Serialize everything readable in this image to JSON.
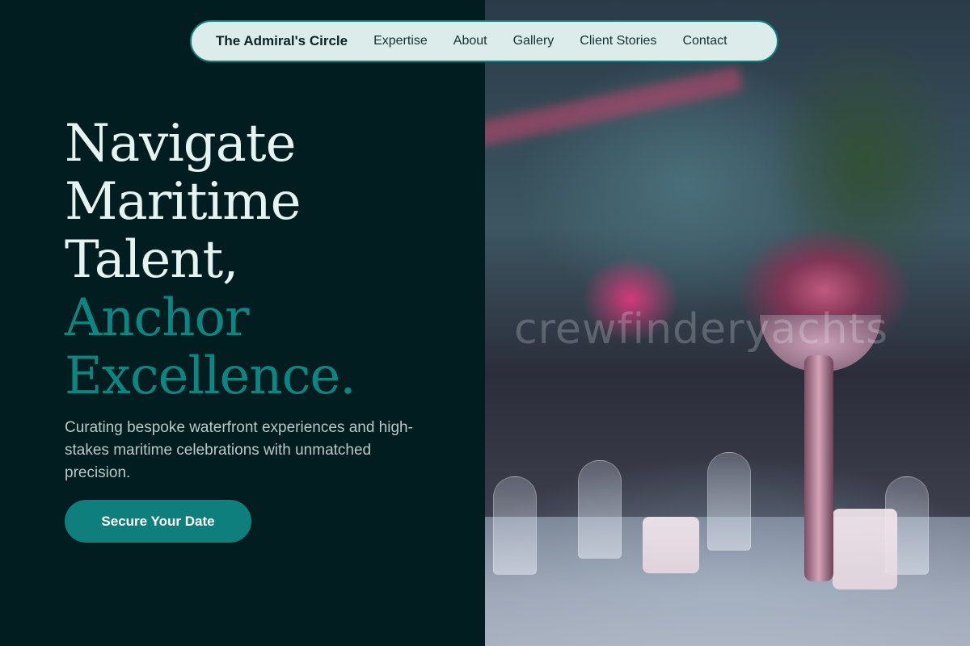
{
  "nav": {
    "brand": "The Admiral's Circle",
    "links": [
      "Expertise",
      "About",
      "Gallery",
      "Client Stories",
      "Contact"
    ]
  },
  "hero": {
    "title_lines": [
      "Navigate",
      "Maritime",
      "Talent,"
    ],
    "accent_lines": [
      "Anchor",
      "Excellence."
    ],
    "subtitle": "Curating bespoke waterfront experiences and high-stakes maritime celebrations with unmatched precision.",
    "cta_label": "Secure Your Date"
  },
  "image": {
    "watermark": "crewfinderyachts"
  },
  "colors": {
    "background": "#011d1f",
    "accent": "#0d8582",
    "nav_background": "#dcecea",
    "heading": "#e5f3f1"
  }
}
